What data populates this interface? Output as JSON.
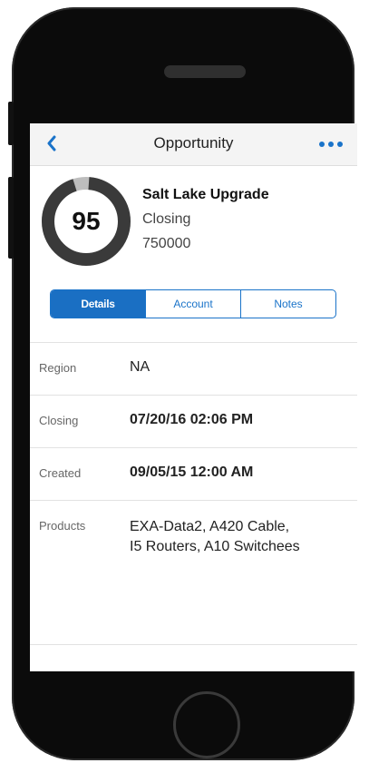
{
  "navbar": {
    "title": "Opportunity"
  },
  "header": {
    "score": "95",
    "score_fraction": 0.95,
    "name": "Salt Lake Upgrade",
    "stage": "Closing",
    "amount": "750000"
  },
  "tabs": [
    {
      "label": "Details",
      "active": true
    },
    {
      "label": "Account",
      "active": false
    },
    {
      "label": "Notes",
      "active": false
    }
  ],
  "details": [
    {
      "label": "Region",
      "value": "NA"
    },
    {
      "label": "Closing",
      "value": "07/20/16 02:06 PM"
    },
    {
      "label": "Created",
      "value": "09/05/15 12:00 AM"
    },
    {
      "label": "Products",
      "value_line1": "EXA-Data2, A420 Cable,",
      "value_line2": "I5 Routers, A10 Switchees"
    }
  ],
  "colors": {
    "accent": "#1a73c9",
    "gauge_track": "#bdbdbd",
    "gauge_fill": "#3a3a3a"
  },
  "icons": {
    "back": "chevron-left-icon",
    "more": "more-dots-icon"
  }
}
